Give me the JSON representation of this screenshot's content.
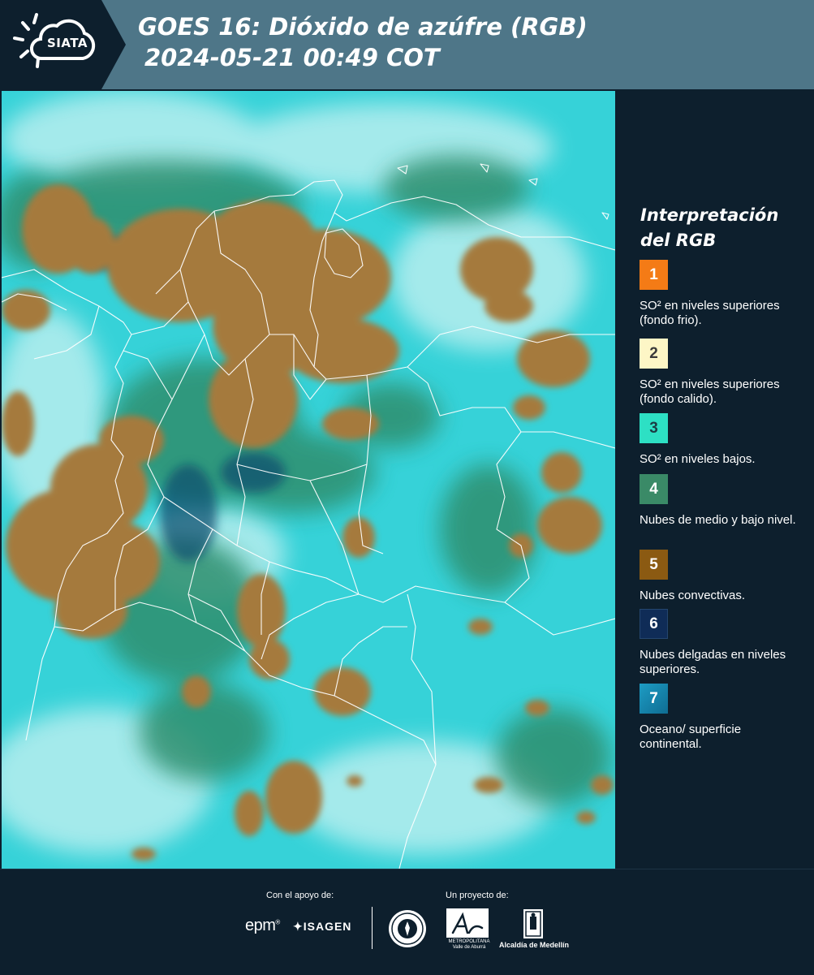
{
  "header": {
    "logo_text": "SIATA",
    "title_line1": "GOES 16: Dióxido de azúfre (RGB)",
    "title_line2": "2024-05-21 00:49 COT"
  },
  "legend": {
    "title": "Interpretación del RGB",
    "items": [
      {
        "number": "1",
        "color": "#f47b16",
        "text": "SO² en niveles superiores (fondo frio)."
      },
      {
        "number": "2",
        "color": "#fdf6c6",
        "text": "SO² en niveles superiores (fondo calido)."
      },
      {
        "number": "3",
        "color": "#2de0c4",
        "text": "SO² en niveles bajos."
      },
      {
        "number": "4",
        "color": "#3a8a67",
        "text": "Nubes de medio y bajo nivel."
      },
      {
        "number": "5",
        "color": "#8b5a12",
        "text": "Nubes convectivas."
      },
      {
        "number": "6",
        "color": "#0f2c57",
        "text": "Nubes delgadas en niveles superiores."
      },
      {
        "number": "7",
        "color": "#1589b0",
        "text": "Oceano/ superficie continental."
      }
    ]
  },
  "footer": {
    "support_label": "Con el apoyo de:",
    "project_label": "Un proyecto de:",
    "sponsor_epm": "epm",
    "sponsor_isagen": "ISAGEN",
    "area_name": "METROPOLITANA Valle de Aburrá",
    "alcaldia_name": "Alcaldía de Medellín"
  },
  "colors": {
    "header_bg": "#4e7688",
    "panel_bg": "#0d1f2d",
    "map_cyan": "#35d3d8",
    "cloud_brown": "#a57a3c"
  }
}
